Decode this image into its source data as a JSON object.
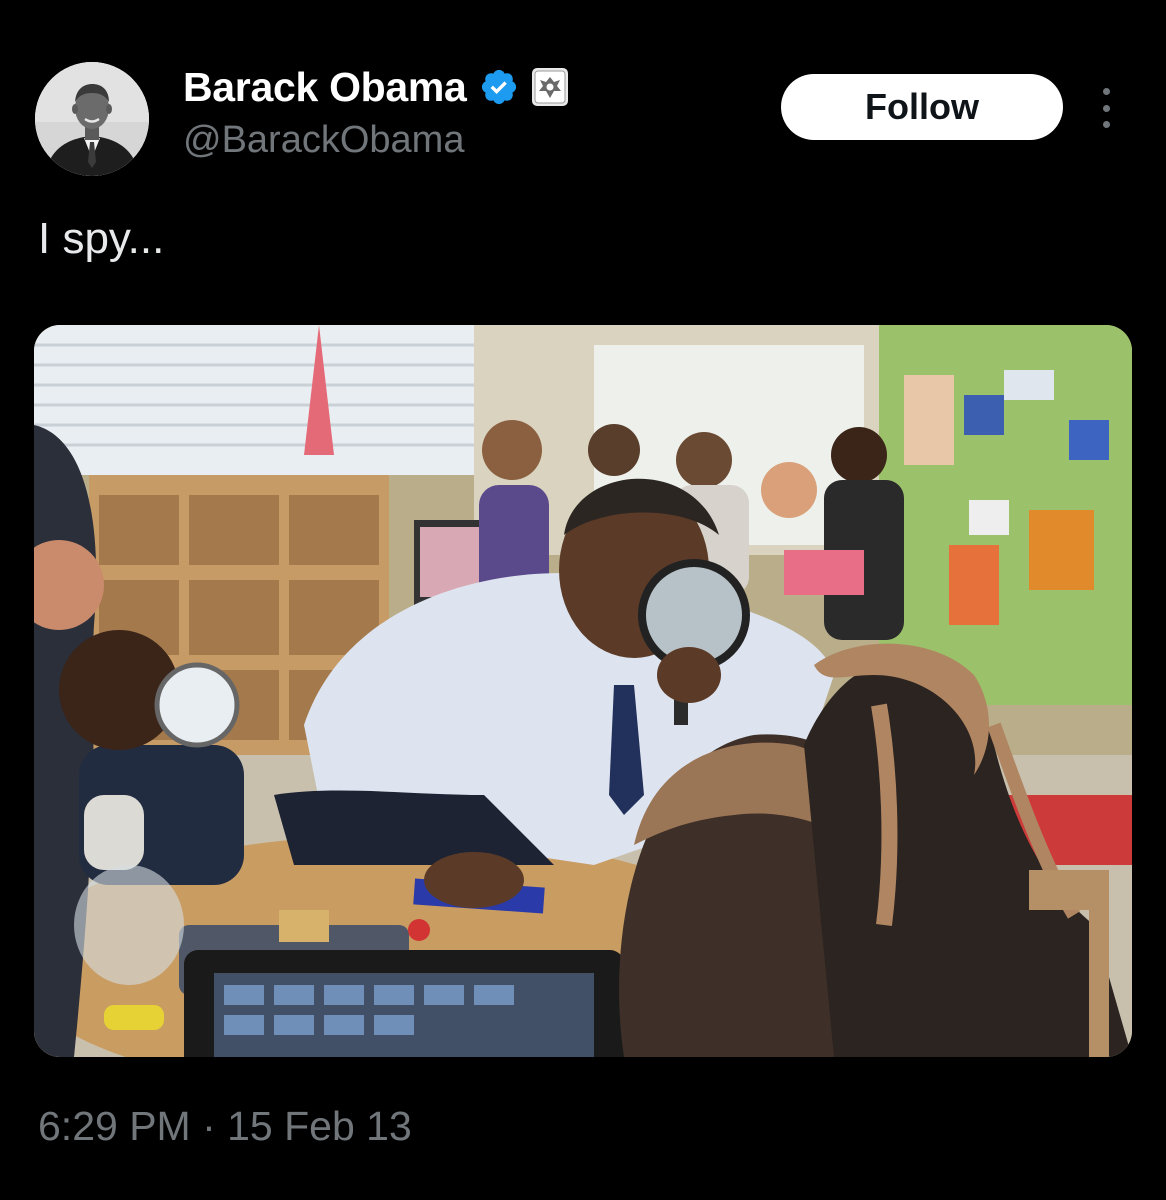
{
  "author": {
    "display_name": "Barack Obama",
    "handle": "@BarackObama",
    "verified": true,
    "verified_color": "#1d9bf0",
    "affiliation_badge": "seal-icon"
  },
  "actions": {
    "follow_label": "Follow",
    "more_icon": "more-options-icon"
  },
  "tweet": {
    "text": "I spy...",
    "timestamp": "6:29 PM · 15 Feb 13"
  },
  "media": {
    "type": "photo"
  },
  "colors": {
    "background": "#000000",
    "text_primary": "#e7e9ea",
    "text_secondary": "#71767b",
    "follow_bg": "#ffffff",
    "follow_text": "#0f1419"
  }
}
